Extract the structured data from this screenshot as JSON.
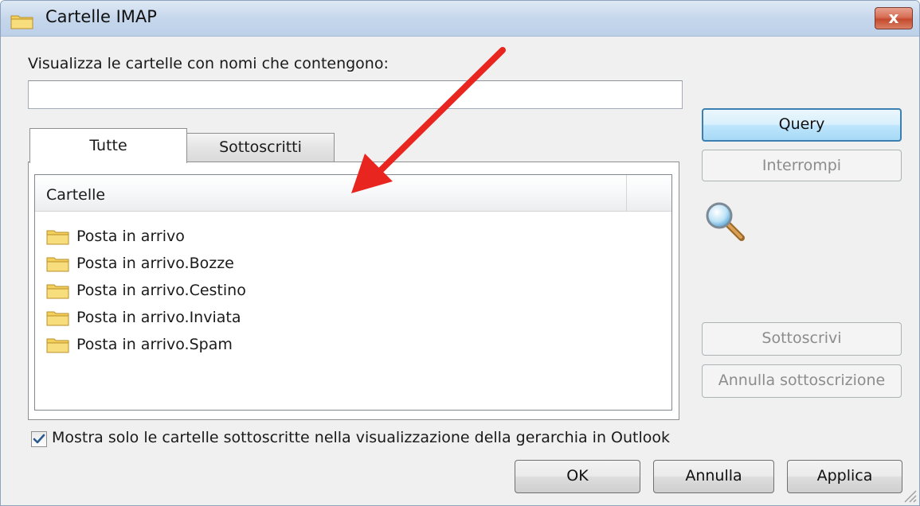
{
  "window": {
    "title": "Cartelle IMAP",
    "close_label": "x"
  },
  "filter": {
    "label": "Visualizza le cartelle con nomi che contengono:",
    "value": ""
  },
  "tabs": [
    {
      "label": "Tutte",
      "active": true
    },
    {
      "label": "Sottoscritti",
      "active": false
    }
  ],
  "list": {
    "column_header": "Cartelle",
    "folders": [
      "Posta in arrivo",
      "Posta in arrivo.Bozze",
      "Posta in arrivo.Cestino",
      "Posta in arrivo.Inviata",
      "Posta in arrivo.Spam"
    ]
  },
  "side_buttons": {
    "query": "Query",
    "interrompi": "Interrompi",
    "sottoscrivi": "Sottoscrivi",
    "annulla_sottoscrizione": "Annulla sottoscrizione"
  },
  "checkbox": {
    "checked": true,
    "label": "Mostra solo le cartelle sottoscritte nella visualizzazione della gerarchia in Outlook"
  },
  "footer": {
    "ok": "OK",
    "annulla": "Annulla",
    "applica": "Applica"
  },
  "icons": {
    "title_icon": "folder-icon",
    "row_icon": "folder-icon",
    "search": "magnifier-icon",
    "annotation": "red-arrow"
  },
  "colors": {
    "annotation_arrow": "#e8251f",
    "default_button_border": "#3c7fb1",
    "close_button": "#c44a2e"
  }
}
